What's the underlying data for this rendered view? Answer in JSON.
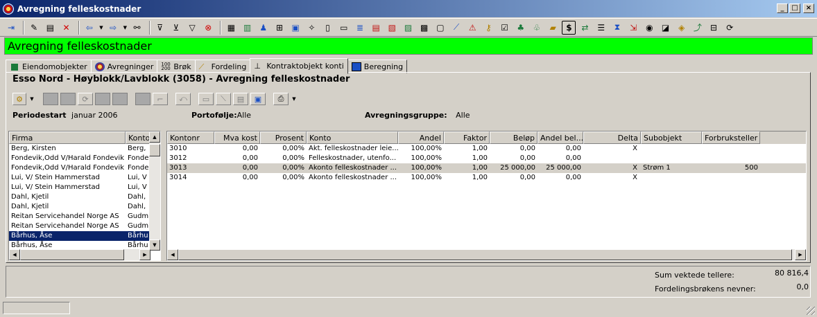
{
  "window": {
    "title": "Avregning felleskostnader"
  },
  "banner": {
    "title": "Avregning felleskostnader"
  },
  "tabs": [
    {
      "label": "Eiendomobjekter",
      "icon": "building-icon"
    },
    {
      "label": "Avregninger",
      "icon": "globe-icon"
    },
    {
      "label": "Brøk",
      "icon": "fraction-icon"
    },
    {
      "label": "Fordeling",
      "icon": "chart-icon"
    },
    {
      "label": "Kontraktobjekt konti",
      "icon": "stamp-icon"
    },
    {
      "label": "Beregning",
      "icon": "calculator-icon"
    }
  ],
  "heading": "Esso Nord - Høyblokk/Lavblokk  (3058) - Avregning felleskostnader",
  "info": {
    "periodestart_label": "Periodestart",
    "periodestart_value": "januar 2006",
    "portefolje_label": "Portofølje:",
    "portefolje_value": "Alle",
    "gruppe_label": "Avregningsgruppe:",
    "gruppe_value": "Alle"
  },
  "left_grid": {
    "columns": [
      "Firma",
      "Kontor"
    ],
    "rows": [
      [
        "Berg, Kirsten",
        "Berg,"
      ],
      [
        "Fondevik,Odd V/Harald Fondevik",
        "Fonde"
      ],
      [
        "Fondevik,Odd V/Harald Fondevik",
        "Fonde"
      ],
      [
        "Lui, V/ Stein Hammerstad",
        "Lui, V"
      ],
      [
        "Lui, V/ Stein Hammerstad",
        "Lui, V"
      ],
      [
        "Dahl, Kjetil",
        "Dahl,"
      ],
      [
        "Dahl, Kjetil",
        "Dahl,"
      ],
      [
        "Reitan Servicehandel Norge AS",
        "Gudm"
      ],
      [
        "Reitan Servicehandel Norge AS",
        "Gudm"
      ],
      [
        "Bårhus, Åse",
        "Bårhu"
      ],
      [
        "Bårhus, Åse",
        "Bårhu"
      ]
    ]
  },
  "right_grid": {
    "columns": [
      "Kontonr",
      "Mva kost",
      "Prosent",
      "Konto",
      "Andel",
      "Faktor",
      "Beløp",
      "Andel bel...",
      "Delta",
      "Subobjekt",
      "Forbruksteller"
    ],
    "rows": [
      [
        "3010",
        "0,00",
        "0,00%",
        "Akt. felleskostnader leie...",
        "100,00%",
        "1,00",
        "0,00",
        "0,00",
        "X",
        "",
        ""
      ],
      [
        "3012",
        "0,00",
        "0,00%",
        "Felleskostnader, utenfo...",
        "100,00%",
        "1,00",
        "0,00",
        "0,00",
        "",
        "",
        ""
      ],
      [
        "3013",
        "0,00",
        "0,00%",
        "Akonto felleskostnader ...",
        "100,00%",
        "1,00",
        "25 000,00",
        "25 000,00",
        "X",
        "Strøm 1",
        "500"
      ],
      [
        "3014",
        "0,00",
        "0,00%",
        "Akonto felleskostnader ...",
        "100,00%",
        "1,00",
        "0,00",
        "0,00",
        "X",
        "",
        ""
      ]
    ]
  },
  "summary": {
    "sum_label": "Sum vektede tellere:",
    "sum_value": "80 816,4",
    "nevner_label": "Fordelingsbrøkens nevner:",
    "nevner_value": "0,0"
  }
}
